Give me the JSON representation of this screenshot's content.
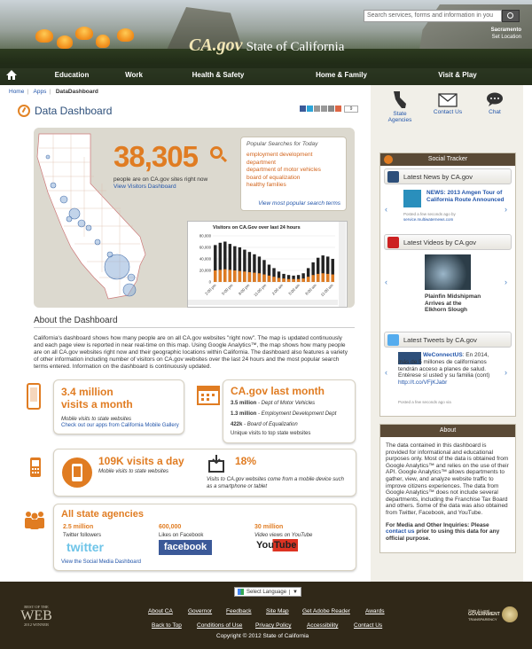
{
  "header": {
    "logo_prefix": "CA.gov",
    "logo_title": "State of California",
    "search_placeholder": "Search services, forms and information in you",
    "location_city": "Sacramento",
    "location_link": "Set Location"
  },
  "nav": {
    "items": [
      "Education",
      "Work",
      "Health & Safety",
      "Home & Family",
      "Visit & Play"
    ]
  },
  "breadcrumb": [
    "Home",
    "Apps",
    "DataDashboard"
  ],
  "page_title": "Data Dashboard",
  "share_count": "9",
  "visitors": {
    "count": "38,305",
    "caption": "people are on CA.gov sites right now",
    "link": "View Visitors Dashboard"
  },
  "popular": {
    "heading": "Popular Searches for Today",
    "items": [
      "employment development department",
      "department of motor vehicles",
      "board of equalization",
      "healthy families"
    ],
    "more": "View most popular search terms"
  },
  "chart_data": {
    "type": "bar",
    "title": "Visitors on CA.Gov over last 24 hours",
    "ylim": [
      0,
      80000
    ],
    "yticks": [
      "80,000",
      "60,000",
      "40,000",
      "20,000",
      "0"
    ],
    "xticks": [
      "2:00 pm",
      "5:00 pm",
      "8:00 pm",
      "11:00 pm",
      "2:00 am",
      "5:00 am",
      "8:00 am",
      "11:00 am"
    ],
    "series": [
      {
        "color": "#222222",
        "values": [
          64000,
          68000,
          70000,
          66000,
          62000,
          60000,
          56000,
          52000,
          48000,
          44000,
          38000,
          30000,
          24000,
          18000,
          14000,
          12000,
          11000,
          12000,
          15000,
          24000,
          34000,
          42000,
          46000,
          44000,
          40000
        ]
      },
      {
        "color": "#e07c22",
        "values": [
          20000,
          21000,
          22000,
          21000,
          20000,
          19000,
          18000,
          17000,
          16000,
          15000,
          13000,
          11000,
          9000,
          7000,
          6000,
          5000,
          5000,
          5000,
          6000,
          9000,
          12000,
          14000,
          15000,
          14000,
          13000
        ]
      }
    ]
  },
  "about": {
    "heading": "About the Dashboard",
    "text": "California's dashboard shows how many people are on all CA.gov websites \"right now\". The map is updated continuously and each page view is reported in near real-time on this map. Using Google Analytics™, the map shows how many people are on all CA.gov websites right now and their geographic locations within California. The dashboard also features a variety of other information including number of visitors on CA.gov websites over the last 24 hours and the most popular search terms entered. Information on the dashboard is continuously updated."
  },
  "mobile": {
    "big": "3.4 million",
    "big2": "visits a month",
    "caption": "Mobile visits to state websites",
    "link": "Check out our apps from California Mobile Gallery"
  },
  "lastmonth": {
    "heading": "CA.gov last month",
    "rows": [
      {
        "value": "3.5 million",
        "label": "- Dept of Motor Vehicles"
      },
      {
        "value": "1.3 million",
        "label": "- Employment Development Dept"
      },
      {
        "value": "422k",
        "label": "- Board of Equalization"
      }
    ],
    "caption": "Unique visits to top state websites"
  },
  "daily": {
    "big": "109K visits a day",
    "caption": "Mobile visits to state websites"
  },
  "percent": {
    "big": "18%",
    "caption": "Visits to CA.gov websites come from a mobile device such as a smartphone or tablet"
  },
  "agencies": {
    "heading": "All state agencies",
    "twitter_num": "2.5 million",
    "twitter_label": "Twitter followers",
    "twitter_logo": "twitter",
    "facebook_num": "600,000",
    "facebook_label": "Likes on Facebook",
    "facebook_logo": "facebook",
    "youtube_num": "30 million",
    "youtube_label": "Video views on YouTube",
    "youtube_logo": "YouTube",
    "link": "View the Social Media Dashboard"
  },
  "side": {
    "icons": [
      {
        "label": "State Agencies"
      },
      {
        "label": "Contact Us"
      },
      {
        "label": "Chat"
      }
    ],
    "tracker": "Social Tracker",
    "news_heading": "Latest News by CA.gov",
    "news_title": "NEWS: 2013 Amgen Tour of California Route Announced",
    "news_meta": "Posted a few seconds ago by",
    "news_link": "service.multiwaternews.com",
    "videos_heading": "Latest Videos by CA.gov",
    "video_title": "Plainfin Midshipman Arrives at the Elkhorn Slough",
    "tweets_heading": "Latest Tweets by CA.gov",
    "tweet_user": "WeConnectUS",
    "tweet_text": ": En 2014, más de 5 millones de californianos tendrán acceso a planes de salud. Entérese sí usted y su familia (cont)",
    "tweet_link": "http://t.co/VFjKJabr",
    "tweet_meta": "Posted a few seconds ago via",
    "about_heading": "About",
    "about_text": "The data contained in this dashboard is provided for informational and educational purposes only. Most of the data is obtained from Google Analytics™ and relies on the use of their API. Google Analytics™ allows departments to gather, view, and analyze website traffic to improve citizens experiences. The data from Google Analytics™ does not include several departments, including the Franchise Tax Board and others. Some of the data was also obtained from Twitter, Facebook, and YouTube.",
    "about_bold1": "For Media and Other Inquiries: Please",
    "about_link": "contact us",
    "about_bold2": "prior to using this data for any official purpose."
  },
  "footer": {
    "language": "Select Language",
    "links1": [
      "About CA",
      "Governor",
      "Feedback",
      "Site Map",
      "Get Adobe Reader",
      "Awards"
    ],
    "links2": [
      "Back to Top",
      "Conditions of Use",
      "Privacy Policy",
      "Accessibility",
      "Contact Us"
    ],
    "copyright": "Copyright © 2012 State of California",
    "award_top": "BEST OF THE",
    "award_web": "WEB",
    "award_year": "2012 WINNER",
    "gov_line1": "State & Local",
    "gov_line2": "GOVERNMENT",
    "gov_line3": "TRANSPARENCY"
  }
}
